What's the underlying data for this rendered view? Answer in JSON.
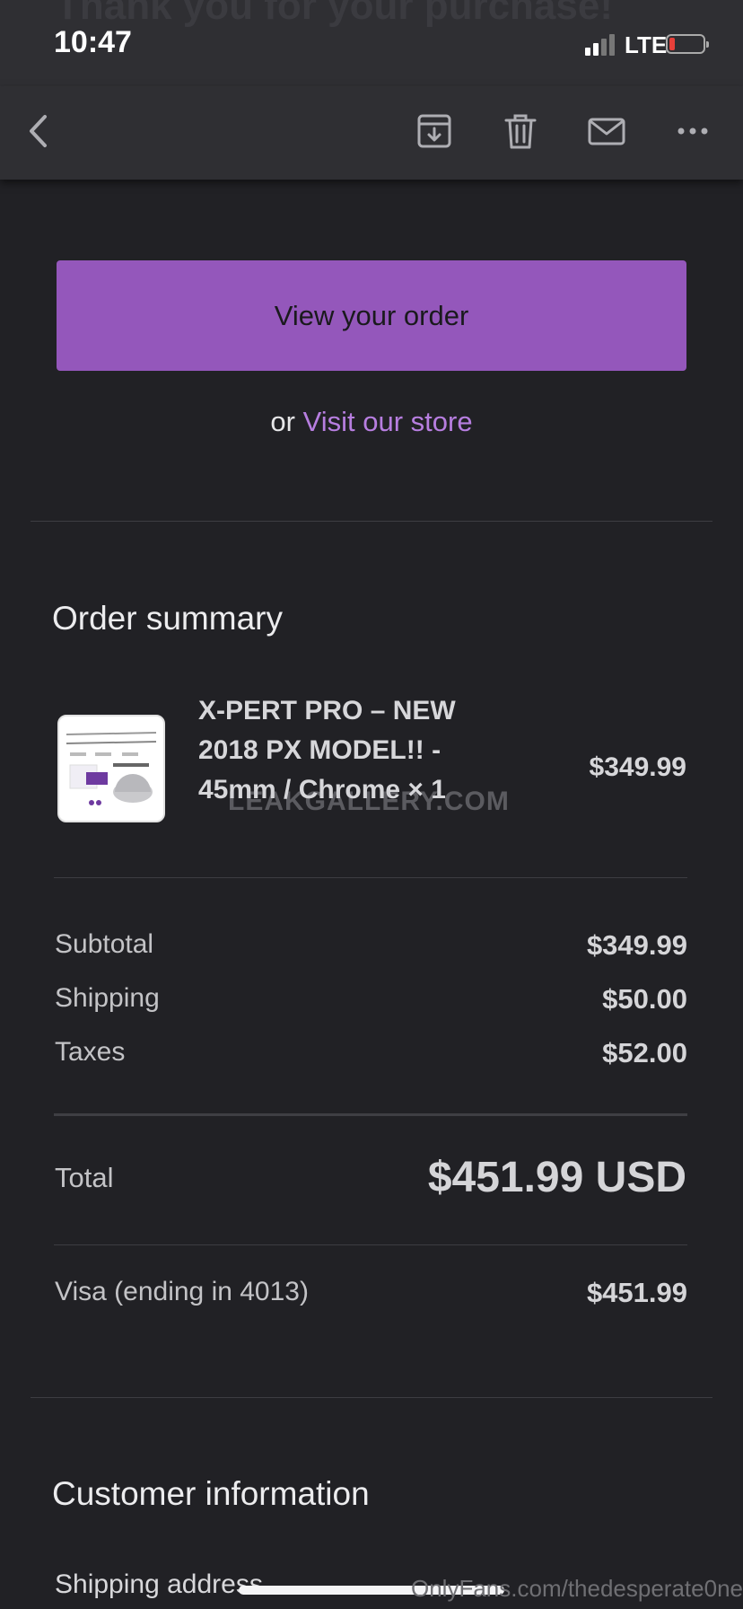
{
  "status_bar": {
    "time": "10:47",
    "network": "LTE"
  },
  "background_heading": "Thank you for your purchase!",
  "toolbar": {
    "back_icon": "chevron-left-icon",
    "archive_icon": "archive-icon",
    "trash_icon": "trash-icon",
    "mail_icon": "mail-icon",
    "more_icon": "more-horizontal-icon"
  },
  "actions": {
    "view_order_label": "View your order",
    "or_text": "or",
    "visit_store_label": "Visit our store"
  },
  "order_summary": {
    "title": "Order summary",
    "item": {
      "name": "X-PERT PRO – NEW 2018 PX MODEL!! - 45mm / Chrome × 1",
      "price": "$349.99"
    },
    "watermark": "LEAKGALLERY.COM",
    "rows": [
      {
        "label": "Subtotal",
        "value": "$349.99"
      },
      {
        "label": "Shipping",
        "value": "$50.00"
      },
      {
        "label": "Taxes",
        "value": "$52.00"
      }
    ],
    "total_label": "Total",
    "total_value": "$451.99 USD",
    "payment_label": "Visa (ending in 4013)",
    "payment_value": "$451.99"
  },
  "customer_information": {
    "title": "Customer information",
    "shipping_address_label": "Shipping address"
  },
  "footer_watermark": "OnlyFans.com/thedesperate0ne",
  "colors": {
    "accent": "#9457bb",
    "link": "#b77ee0",
    "background": "#212125",
    "toolbar": "#2f2f33"
  }
}
